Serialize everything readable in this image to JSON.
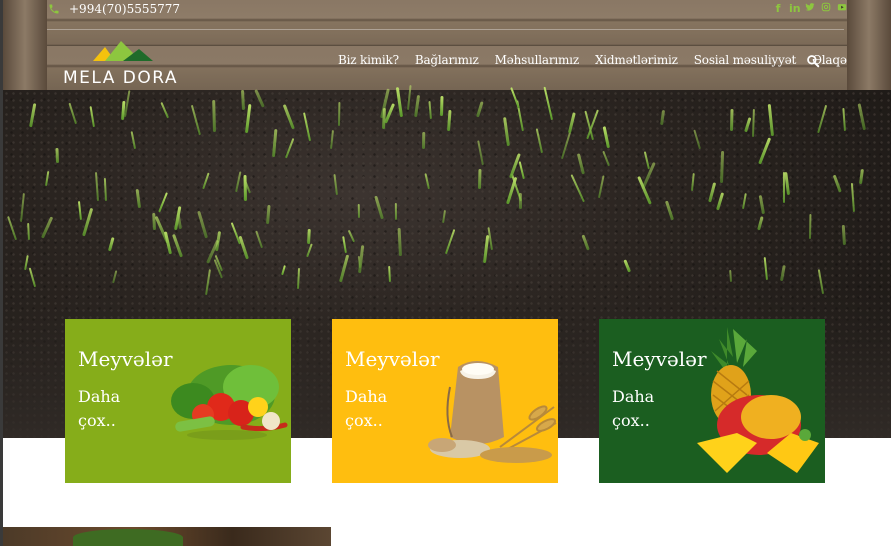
{
  "topbar": {
    "phone": "+994(70)5555777",
    "social_icons": [
      "facebook-icon",
      "linkedin-icon",
      "twitter-icon",
      "instagram-icon",
      "youtube-icon"
    ]
  },
  "brand": {
    "name": "MELA DORA",
    "colors": {
      "green": "#8dc63f",
      "yellow": "#f4c20d",
      "dark_green": "#1f6b2a"
    }
  },
  "nav": {
    "items": [
      "Biz kimik?",
      "Bağlarımız",
      "Məhsullarımız",
      "Xidmətlərimiz",
      "Sosial məsuliyyət",
      "Əlaqə"
    ],
    "search_icon": "search-icon"
  },
  "cards": [
    {
      "title": "Meyvələr",
      "more": "Daha çox..",
      "color": "#86ad1a",
      "image": "vegetables"
    },
    {
      "title": "Meyvələr",
      "more": "Daha çox..",
      "color": "#ffbe0f",
      "image": "flour-sack-and-wheat"
    },
    {
      "title": "Meyvələr",
      "more": "Daha çox..",
      "color": "#1b5e20",
      "image": "pineapple-and-mango"
    }
  ]
}
